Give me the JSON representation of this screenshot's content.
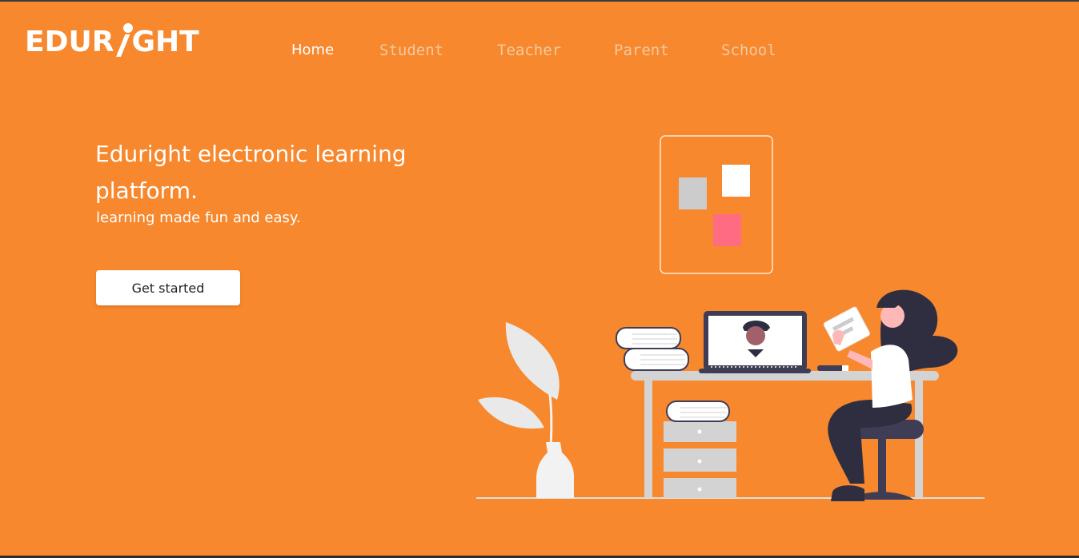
{
  "brand": {
    "logo_left": "EDUR",
    "logo_right": "GHT"
  },
  "nav": {
    "items": [
      {
        "label": "Home",
        "active": true
      },
      {
        "label": "Student",
        "active": false
      },
      {
        "label": "Teacher",
        "active": false
      },
      {
        "label": "Parent",
        "active": false
      },
      {
        "label": "School",
        "active": false
      }
    ]
  },
  "hero": {
    "title": "Eduright electronic learning platform.",
    "subtitle": "learning made fun and easy.",
    "cta_label": "Get started"
  },
  "colors": {
    "background": "#F7882D",
    "text": "#FFFFFF",
    "nav_inactive": "#F4C9A0",
    "accent_pink": "#FF6B81"
  }
}
